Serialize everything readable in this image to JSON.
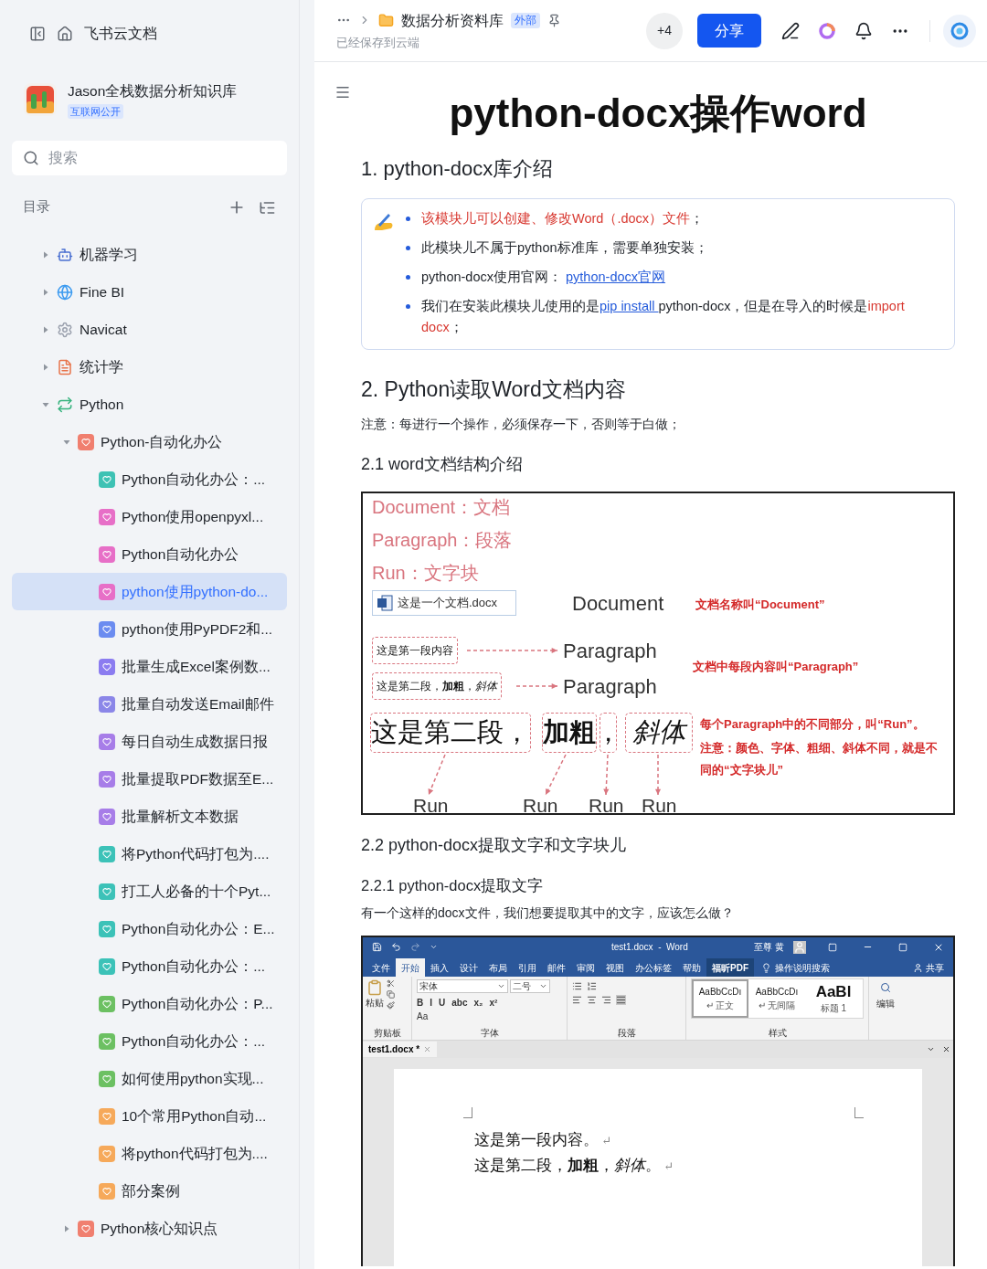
{
  "sidebar": {
    "title": "飞书云文档",
    "workspace": {
      "name": "Jason全栈数据分析知识库",
      "badge": "互联网公开"
    },
    "search": {
      "placeholder": "搜索"
    },
    "toc_label": "目录",
    "tree": [
      {
        "label": "机器学习",
        "expanded": false,
        "selected": false
      },
      {
        "label": "Fine BI",
        "expanded": false,
        "selected": false
      },
      {
        "label": "Navicat",
        "expanded": false,
        "selected": false
      },
      {
        "label": "统计学",
        "expanded": false,
        "selected": false
      },
      {
        "label": "Python",
        "expanded": true,
        "selected": false,
        "children": [
          {
            "label": "Python-自动化办公",
            "color": "#f07f6f",
            "expanded": true,
            "selected": false,
            "children": [
              {
                "label": "Python自动化办公：...",
                "color": "#3ec2b4",
                "selected": false
              },
              {
                "label": "Python使用openpyxl...",
                "color": "#e76fc7",
                "selected": false
              },
              {
                "label": "Python自动化办公",
                "color": "#e76fc7",
                "selected": false
              },
              {
                "label": "python使用python-do...",
                "color": "#e76fc7",
                "selected": true
              },
              {
                "label": "python使用PyPDF2和...",
                "color": "#6b8cf0",
                "selected": false
              },
              {
                "label": "批量生成Excel案例数...",
                "color": "#8b7cf0",
                "selected": false
              },
              {
                "label": "批量自动发送Email邮件",
                "color": "#8b86e8",
                "selected": false
              },
              {
                "label": "每日自动生成数据日报",
                "color": "#a77de8",
                "selected": false
              },
              {
                "label": "批量提取PDF数据至E...",
                "color": "#a77de8",
                "selected": false
              },
              {
                "label": "批量解析文本数据",
                "color": "#a77de8",
                "selected": false
              },
              {
                "label": "将Python代码打包为....",
                "color": "#3cc2b8",
                "selected": false
              },
              {
                "label": "打工人必备的十个Pyt...",
                "color": "#3cc2b8",
                "selected": false
              },
              {
                "label": "Python自动化办公：E...",
                "color": "#3cc2b8",
                "selected": false
              },
              {
                "label": "Python自动化办公：...",
                "color": "#3cc2b8",
                "selected": false
              },
              {
                "label": "Python自动化办公：P...",
                "color": "#6cc062",
                "selected": false
              },
              {
                "label": "Python自动化办公：...",
                "color": "#6cc062",
                "selected": false
              },
              {
                "label": "如何使用python实现...",
                "color": "#6cc062",
                "selected": false
              },
              {
                "label": "10个常用Python自动...",
                "color": "#f6a95a",
                "selected": false
              },
              {
                "label": "将python代码打包为....",
                "color": "#f6a95a",
                "selected": false
              },
              {
                "label": "部分案例",
                "color": "#f6a95a",
                "selected": false
              }
            ]
          },
          {
            "label": "Python核心知识点",
            "color": "#f07f6f",
            "expanded": false,
            "selected": false
          }
        ]
      }
    ]
  },
  "header": {
    "folder": "数据分析资料库",
    "badge": "外部",
    "saved": "已经保存到云端",
    "collaborators": "+4",
    "share": "分享"
  },
  "doc": {
    "title": "python-docx操作word",
    "h1": "1. python-docx库介绍",
    "bullets": [
      [
        {
          "kind": "red",
          "text": "该模块儿可以创建、修改Word（.docx）文件"
        },
        {
          "kind": "plain",
          "text": "；"
        }
      ],
      [
        {
          "kind": "plain",
          "text": "此模块儿不属于python标准库，需要单独安装；"
        }
      ],
      [
        {
          "kind": "plain",
          "text": "python-docx使用官网： "
        },
        {
          "kind": "link",
          "text": "python-docx官网"
        }
      ],
      [
        {
          "kind": "plain",
          "text": "我们在安装此模块儿使用的是"
        },
        {
          "kind": "link",
          "text": "pip install "
        },
        {
          "kind": "plain",
          "text": "python-docx，但是在导入的时候是"
        },
        {
          "kind": "red",
          "text": "import docx"
        },
        {
          "kind": "plain",
          "text": "；"
        }
      ]
    ],
    "h2": "2. Python读取Word文档内容",
    "note": "注意：每进行一个操作，必须保存一下，否则等于白做；",
    "h3a": "2.1 word文档结构介绍",
    "diagram": {
      "legend": [
        "Document：文档",
        "Paragraph：段落",
        "Run：文字块"
      ],
      "file_chip": "这是一个文档.docx",
      "document_label": "Document",
      "document_note": "文档名称叫“Document”",
      "paragraph_boxes": [
        "这是第一段内容",
        "这是第二段，**加粗**，*斜体*"
      ],
      "paragraph_labels": [
        "Paragraph",
        "Paragraph"
      ],
      "paragraph_note": "文档中每段内容叫“Paragraph”",
      "runs": [
        {
          "kind": "plain",
          "text": "这是第二段，"
        },
        {
          "kind": "bold",
          "text": "加粗"
        },
        {
          "kind": "plain",
          "text": "，"
        },
        {
          "kind": "italic",
          "text": "斜体"
        }
      ],
      "run_labels": [
        "Run",
        "Run",
        "Run",
        "Run"
      ],
      "run_notes": [
        "每个Paragraph中的不同部分，叫“Run”。",
        "注意：颜色、字体、粗细、斜体不同，就是不同的“文字块儿”"
      ]
    },
    "h3b": "2.2 python-docx提取文字和文字块儿",
    "h4": "2.2.1 python-docx提取文字",
    "question": "有一个这样的docx文件，我们想要提取其中的文字，应该怎么做？",
    "word": {
      "title": "test1.docx  -  Word",
      "user": "至尊 黄",
      "tabs": [
        {
          "label": "文件",
          "selected": false,
          "highlighted": false
        },
        {
          "label": "开始",
          "selected": true,
          "highlighted": false
        },
        {
          "label": "插入",
          "selected": false,
          "highlighted": false
        },
        {
          "label": "设计",
          "selected": false,
          "highlighted": false
        },
        {
          "label": "布局",
          "selected": false,
          "highlighted": false
        },
        {
          "label": "引用",
          "selected": false,
          "highlighted": false
        },
        {
          "label": "邮件",
          "selected": false,
          "highlighted": false
        },
        {
          "label": "审阅",
          "selected": false,
          "highlighted": false
        },
        {
          "label": "视图",
          "selected": false,
          "highlighted": false
        },
        {
          "label": "办公标签",
          "selected": false,
          "highlighted": false
        },
        {
          "label": "帮助",
          "selected": false,
          "highlighted": false
        },
        {
          "label": "福昕PDF",
          "selected": false,
          "highlighted": true
        }
      ],
      "search": "操作说明搜索",
      "share": "共享",
      "paste": "粘贴",
      "font": "宋体",
      "size": "二号",
      "format_buttons": [
        "B",
        "I",
        "U",
        "abc",
        "x₂",
        "x²"
      ],
      "case_button": "Aa",
      "groups": [
        "剪贴板",
        "字体",
        "段落",
        "样式"
      ],
      "styles": [
        {
          "sample": "AaBbCcDı",
          "name": "↵ 正文",
          "selected": true
        },
        {
          "sample": "AaBbCcDı",
          "name": "↵ 无间隔",
          "selected": false
        },
        {
          "sample": "AaBl",
          "name": "标题 1",
          "selected": false
        }
      ],
      "editing": "编辑",
      "doc_tab": "test1.docx *",
      "lines": [
        {
          "text": "这是第一段内容。",
          "mark": "↵"
        },
        {
          "text": "这是第二段，**加粗**，*斜体*。",
          "mark": "↵"
        }
      ]
    }
  }
}
